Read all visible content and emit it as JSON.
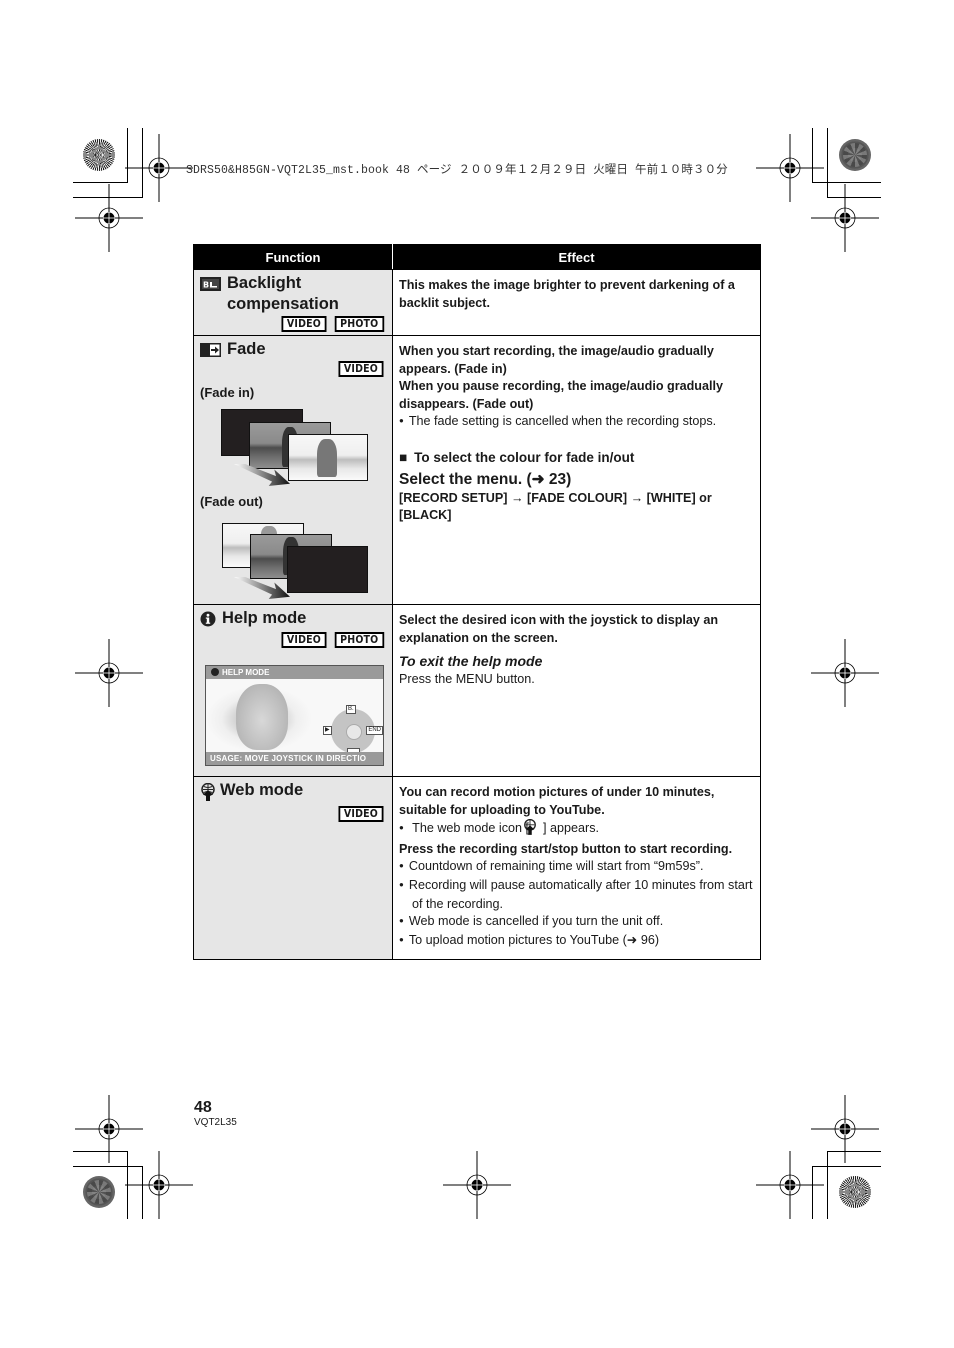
{
  "print_header": "SDRS50&H85GN-VQT2L35_mst.book  48 ページ  ２００９年１２月２９日  火曜日  午前１０時３０分",
  "table": {
    "headers": {
      "function": "Function",
      "effect": "Effect"
    },
    "rows": [
      {
        "icon": "backlight-compensation-icon",
        "title": "Backlight compensation",
        "badges": [
          "VIDEO",
          "PHOTO"
        ],
        "effect": {
          "bold_text": "This makes the image brighter to prevent darkening of a backlit subject."
        }
      },
      {
        "icon": "fade-icon",
        "title": "Fade",
        "badges": [
          "VIDEO"
        ],
        "fade_in_label": "(Fade in)",
        "fade_out_label": "(Fade out)",
        "effect": {
          "p1": "When you start recording, the image/audio gradually appears. (Fade in)",
          "p2": "When you pause recording, the image/audio gradually disappears. (Fade out)",
          "bullet1": "The fade setting is cancelled when the recording stops.",
          "section_heading": "To select the colour for fade in/out",
          "menu_line": "Select the menu. (➜ 23)",
          "menu_path": "[RECORD SETUP] → [FADE COLOUR] → [WHITE] or [BLACK]"
        }
      },
      {
        "icon": "help-info-icon",
        "title": "Help mode",
        "badges": [
          "VIDEO",
          "PHOTO"
        ],
        "screen": {
          "top_bar": "HELP MODE",
          "bottom_bar": "USAGE: MOVE JOYSTICK IN DIRECTIO",
          "joystick_keys": {
            "up": "B.",
            "left": "▶",
            "right": "END",
            "down": ""
          }
        },
        "effect": {
          "bold_text": "Select the desired icon with the joystick to display an explanation on the screen.",
          "italic_heading": "To exit the help mode",
          "plain_text": "Press the MENU button."
        }
      },
      {
        "icon": "web-mode-icon",
        "title": "Web mode",
        "badges": [
          "VIDEO"
        ],
        "effect": {
          "bold1": "You can record motion pictures of under 10 minutes, suitable for uploading to YouTube.",
          "bullet1_pre": "The web mode icon [",
          "bullet1_post": "] appears.",
          "bold2": "Press the recording start/stop button to start recording.",
          "bullets": [
            "Countdown of remaining time will start from “9m59s”.",
            "Recording will pause automatically after 10 minutes from start of the recording.",
            "Web mode is cancelled if you turn the unit off.",
            "To upload motion pictures to YouTube (➜ 96)"
          ]
        }
      }
    ]
  },
  "footer": {
    "page_number": "48",
    "doc_code": "VQT2L35"
  }
}
